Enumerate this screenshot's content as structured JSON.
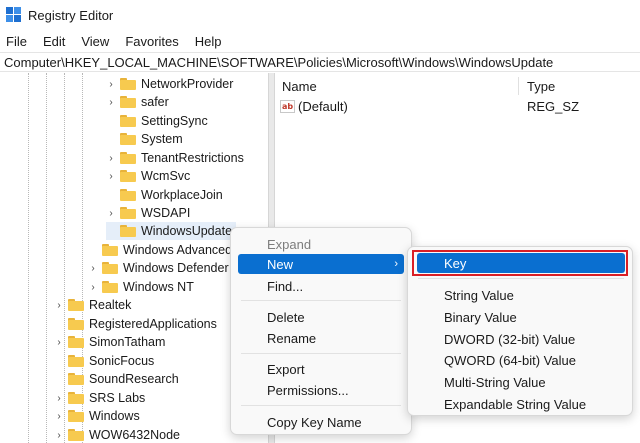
{
  "window": {
    "title": "Registry Editor"
  },
  "menubar": {
    "items": [
      "File",
      "Edit",
      "View",
      "Favorites",
      "Help"
    ]
  },
  "address": {
    "path": "Computer\\HKEY_LOCAL_MACHINE\\SOFTWARE\\Policies\\Microsoft\\Windows\\WindowsUpdate"
  },
  "tree": {
    "items": [
      {
        "label": "NetworkProvider",
        "level": 2,
        "expandable": true
      },
      {
        "label": "safer",
        "level": 2,
        "expandable": true
      },
      {
        "label": "SettingSync",
        "level": 2,
        "expandable": false
      },
      {
        "label": "System",
        "level": 2,
        "expandable": false
      },
      {
        "label": "TenantRestrictions",
        "level": 2,
        "expandable": true
      },
      {
        "label": "WcmSvc",
        "level": 2,
        "expandable": true
      },
      {
        "label": "WorkplaceJoin",
        "level": 2,
        "expandable": false
      },
      {
        "label": "WSDAPI",
        "level": 2,
        "expandable": true
      },
      {
        "label": "WindowsUpdate",
        "level": 2,
        "expandable": false,
        "selected": true
      },
      {
        "label": "Windows Advanced",
        "level": 1,
        "expandable": false
      },
      {
        "label": "Windows Defender",
        "level": 1,
        "expandable": true
      },
      {
        "label": "Windows NT",
        "level": 1,
        "expandable": true
      },
      {
        "label": "Realtek",
        "level": 0,
        "expandable": true
      },
      {
        "label": "RegisteredApplications",
        "level": 0,
        "expandable": false
      },
      {
        "label": "SimonTatham",
        "level": 0,
        "expandable": true
      },
      {
        "label": "SonicFocus",
        "level": 0,
        "expandable": false
      },
      {
        "label": "SoundResearch",
        "level": 0,
        "expandable": false
      },
      {
        "label": "SRS Labs",
        "level": 0,
        "expandable": true
      },
      {
        "label": "Windows",
        "level": 0,
        "expandable": true
      },
      {
        "label": "WOW6432Node",
        "level": 0,
        "expandable": true
      }
    ]
  },
  "values_pane": {
    "columns": {
      "name": "Name",
      "type": "Type"
    },
    "rows": [
      {
        "name": "(Default)",
        "type": "REG_SZ",
        "icon": "string-value-icon"
      }
    ]
  },
  "context_menu": {
    "expand": "Expand",
    "new": "New",
    "find": "Find...",
    "delete": "Delete",
    "rename": "Rename",
    "export": "Export",
    "permissions": "Permissions...",
    "copy_key_name": "Copy Key Name",
    "submenu_arrow": "›"
  },
  "new_submenu": {
    "key": "Key",
    "string_value": "String Value",
    "binary_value": "Binary Value",
    "dword_value": "DWORD (32-bit) Value",
    "qword_value": "QWORD (64-bit) Value",
    "multi_string_value": "Multi-String Value",
    "expandable_string_value": "Expandable String Value"
  },
  "colors": {
    "accent": "#0a6fd0",
    "highlight_box": "#d91f26",
    "folder": "#f7ca4f"
  }
}
